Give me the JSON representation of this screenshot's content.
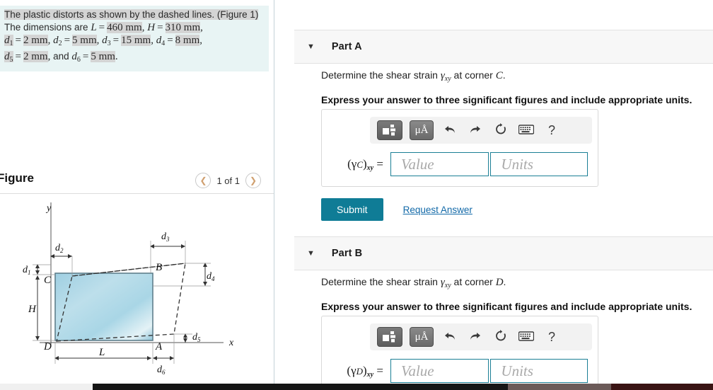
{
  "problem": {
    "line1_a": "The plastic distorts as shown by the dashed lines. (Figure 1)",
    "line2_a": "The dimensions are ",
    "L_sym": "L",
    "L_val": "460 mm",
    "H_sym": "H",
    "H_val": "310 mm",
    "d1_val": "2 mm",
    "d2_val": "5 mm",
    "d3_val": "15 mm",
    "d4_val": "8 mm",
    "d5_val": "2 mm",
    "d6_val": "5 mm",
    "and_word": "and"
  },
  "figure": {
    "title": "Figure",
    "pager_label": "1 of 1",
    "prev_icon": "chevron-left-icon",
    "next_icon": "chevron-right-icon",
    "labels": {
      "y_axis": "y",
      "x_axis": "x",
      "corner_A": "A",
      "corner_B": "B",
      "corner_C": "C",
      "corner_D": "D",
      "dim_L": "L",
      "dim_H": "H",
      "dim_d1": "d",
      "dim_d2": "d",
      "dim_d3": "d",
      "dim_d4": "d",
      "dim_d5": "d",
      "dim_d6": "d"
    }
  },
  "parts": {
    "a": {
      "header": "Part A",
      "caret": "▼",
      "question_pre": "Determine the shear strain ",
      "question_gamma": "γ",
      "question_sub": "xy",
      "question_mid": " at corner ",
      "question_corner": "C",
      "question_end": ".",
      "instruction": "Express your answer to three significant figures and include appropriate units.",
      "answer_symbol_pre": "(γ",
      "answer_symbol_corner": "C",
      "answer_symbol_post": ")",
      "answer_symbol_sub": "xy",
      "answer_symbol_eq": " =",
      "value_placeholder": "Value",
      "units_placeholder": "Units",
      "submit_label": "Submit",
      "request_answer_label": "Request Answer"
    },
    "b": {
      "header": "Part B",
      "caret": "▼",
      "question_pre": "Determine the shear strain ",
      "question_gamma": "γ",
      "question_sub": "xy",
      "question_mid": " at corner ",
      "question_corner": "D",
      "question_end": ".",
      "instruction": "Express your answer to three significant figures and include appropriate units.",
      "answer_symbol_pre": "(γ",
      "answer_symbol_corner": "D",
      "answer_symbol_post": ")",
      "answer_symbol_sub": "xy",
      "answer_symbol_eq": " =",
      "value_placeholder": "Value",
      "units_placeholder": "Units"
    }
  },
  "toolbar": {
    "template_icon": "math-template-icon",
    "units_label": "μÅ",
    "undo_icon": "↰",
    "redo_icon": "↱",
    "reset_icon": "↻",
    "keyboard_icon": "⌨",
    "help_icon": "?"
  },
  "colors": {
    "accent_teal": "#0f7c96",
    "link_blue": "#1269a8",
    "statement_bg": "#e8f4f4",
    "part_header_bg": "#f7f7f7",
    "input_border": "#1b7f95",
    "figure_fill": "#a8d4e4"
  }
}
